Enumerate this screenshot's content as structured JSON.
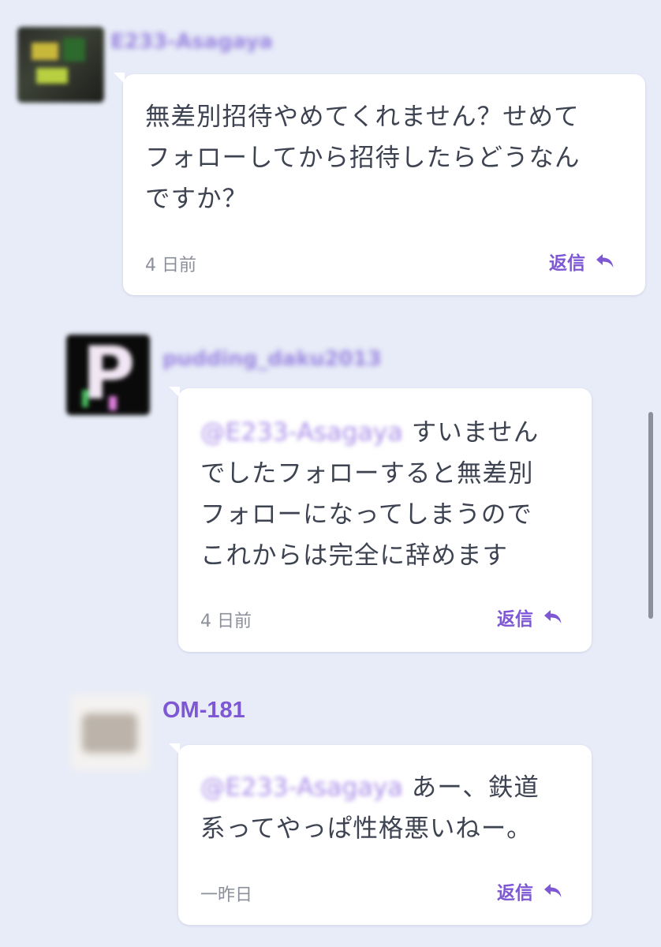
{
  "comments": [
    {
      "username": "E233-Asagaya",
      "text": "無差別招待やめてくれません？せめて\nフォローしてから招待したらどうなん\nですか？",
      "time": "4 日前",
      "reply_label": "返信"
    },
    {
      "username": "pudding_daku2013",
      "mention": "@E233-Asagaya",
      "text_first": "すいません",
      "text_rest": "でしたフォローすると無差別\nフォローになってしまうので\nこれからは完全に辞めます",
      "time": "4 日前",
      "reply_label": "返信"
    },
    {
      "username": "OM-181",
      "mention": "@E233-Asagaya",
      "text_first": "あー、鉄道",
      "text_rest": "系ってやっぱ性格悪いねー。",
      "time": "一昨日",
      "reply_label": "返信"
    }
  ],
  "colors": {
    "background": "#e8ecf8",
    "accent": "#7e57d4",
    "text": "#3e4352",
    "muted": "#8b8f99"
  },
  "icons": {
    "reply": "reply-arrow-icon"
  }
}
